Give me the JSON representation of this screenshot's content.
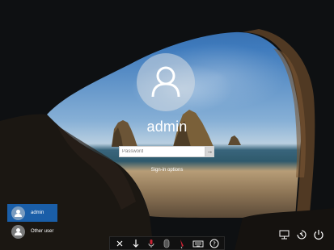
{
  "login": {
    "username": "admin",
    "password_placeholder": "Password",
    "signin_options": "Sign-in options"
  },
  "users": [
    {
      "label": "admin",
      "selected": true
    },
    {
      "label": "Other user",
      "selected": false
    }
  ],
  "corner_icons": [
    "network-icon",
    "ease-of-access-icon",
    "power-icon"
  ],
  "taskbar_icons": [
    "close-icon",
    "arrow-down-icon",
    "microphone-icon",
    "mouse-icon",
    "pen-icon",
    "keyboard-icon",
    "help-icon"
  ],
  "colors": {
    "selected_user": "#1a5ea8",
    "taskbar": "#111111",
    "text": "#ffffff"
  }
}
